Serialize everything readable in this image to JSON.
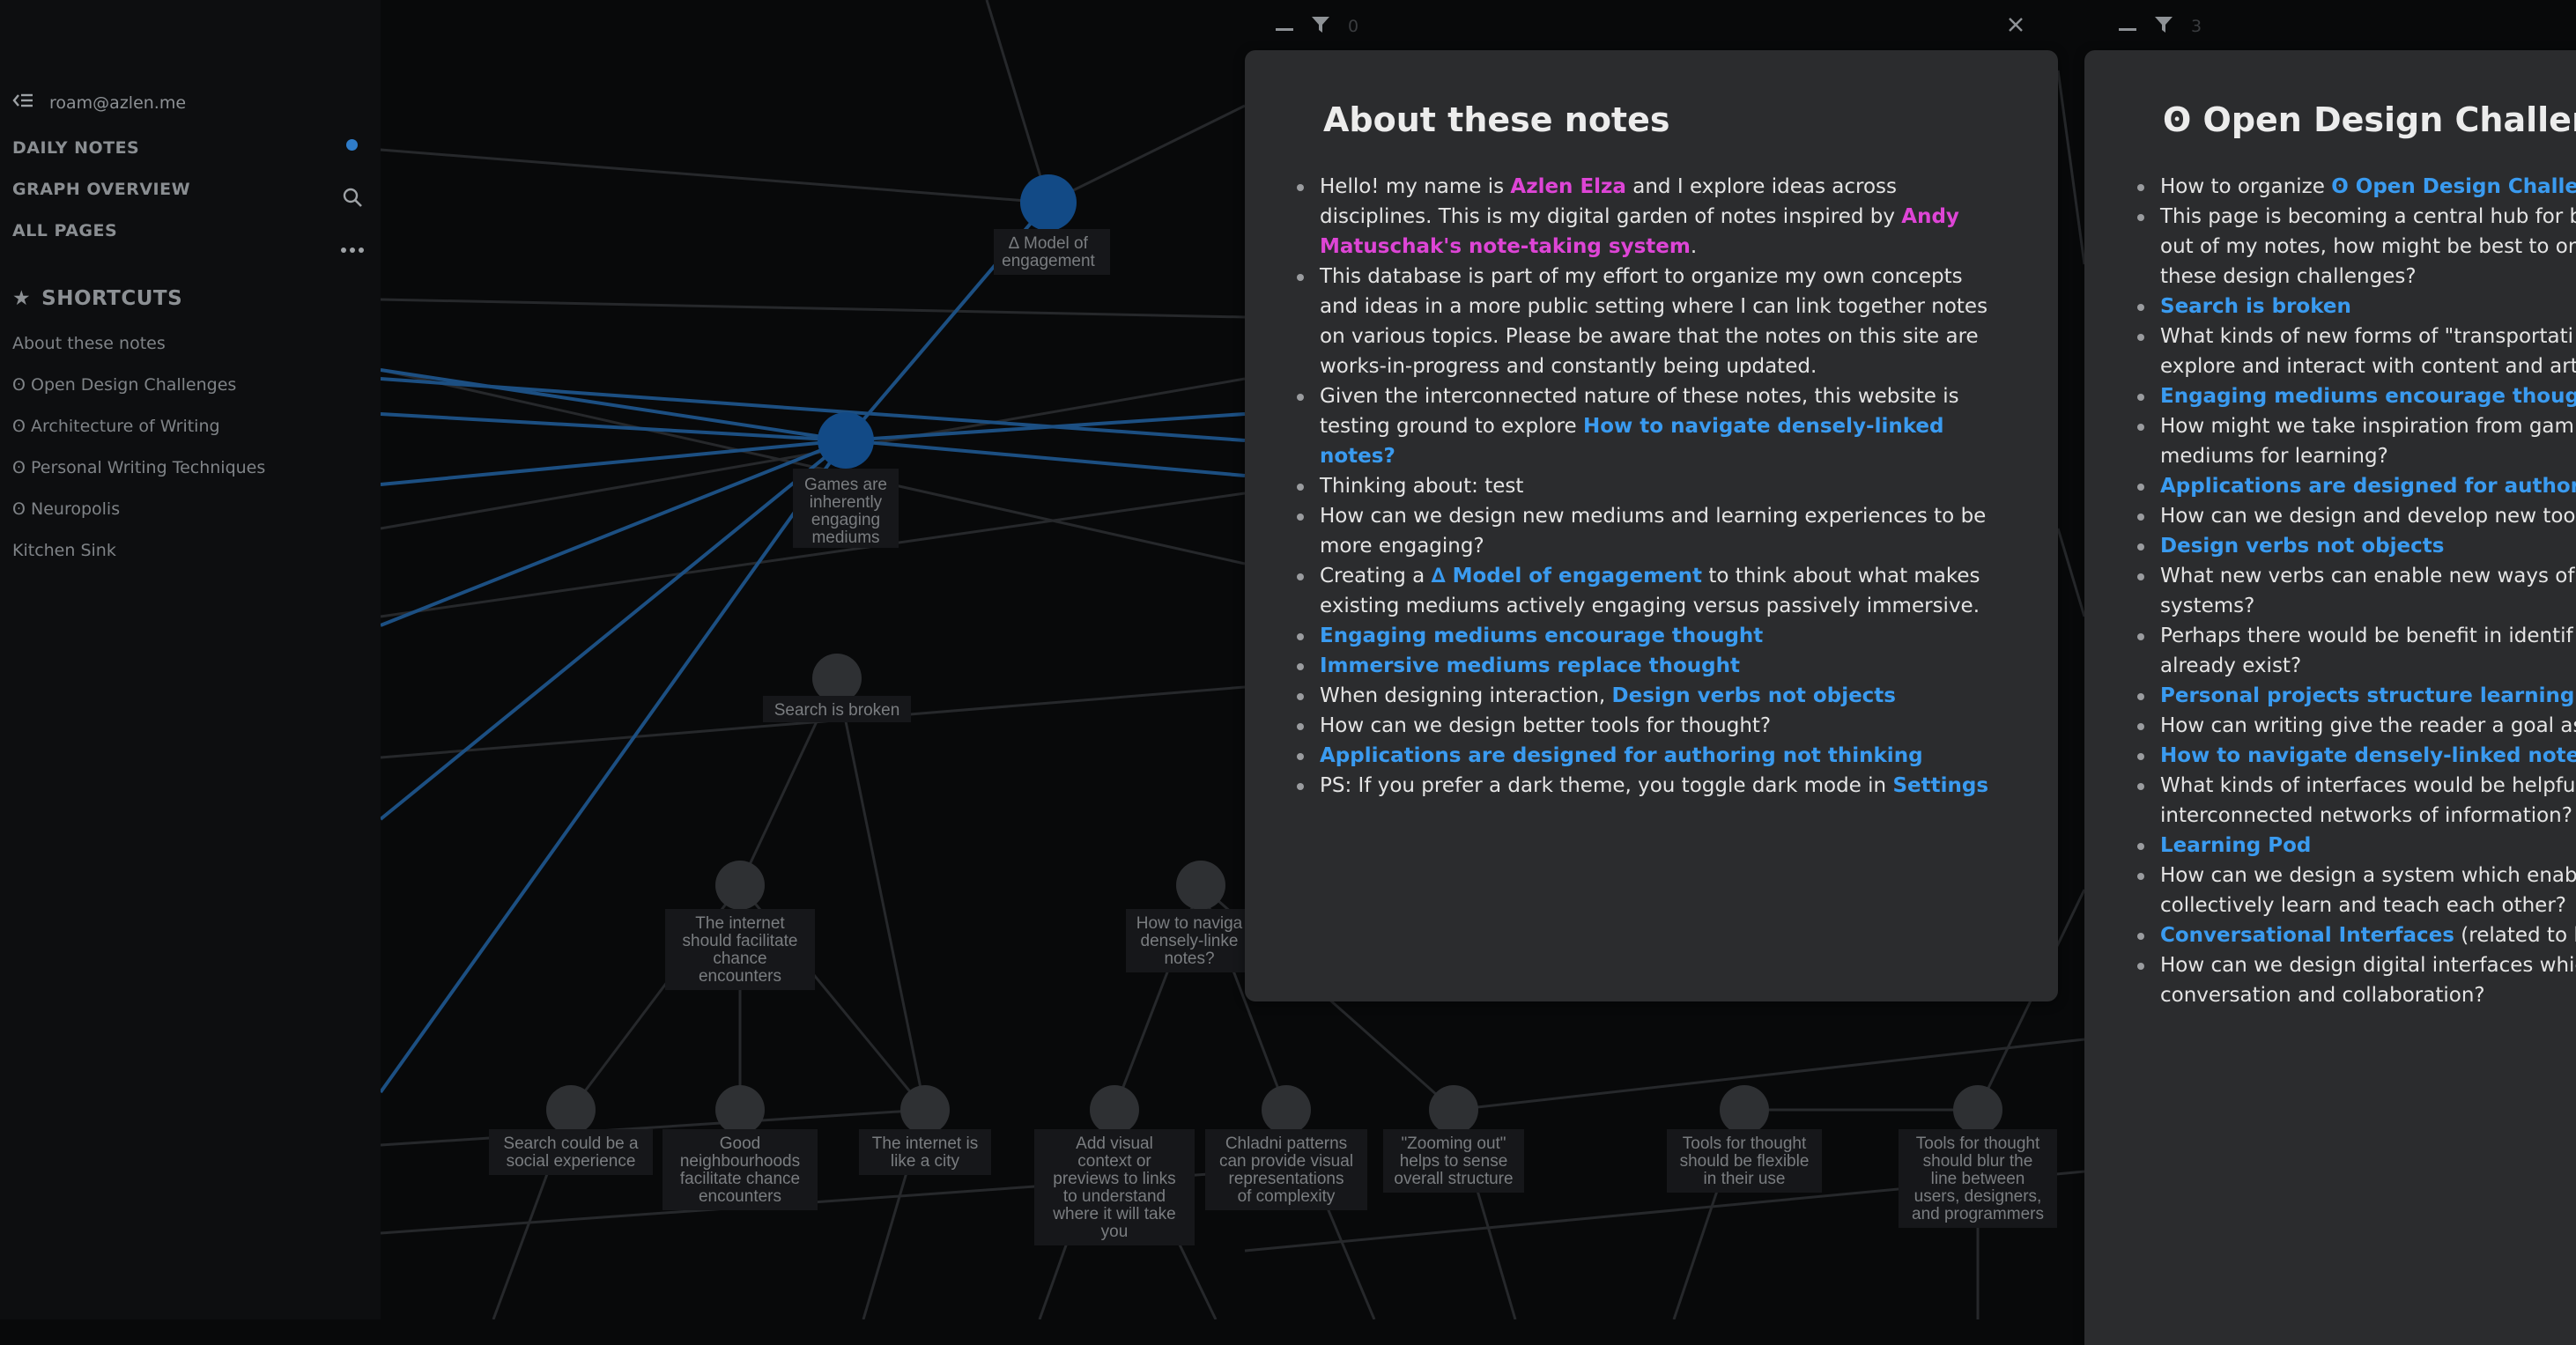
{
  "sidebar": {
    "user": "roam@azlen.me",
    "nav": [
      "DAILY NOTES",
      "GRAPH OVERVIEW",
      "ALL PAGES"
    ],
    "shortcuts_title": "SHORTCUTS",
    "shortcuts": [
      "About these notes",
      "ʘ Open Design Challenges",
      "ʘ Architecture of Writing",
      "ʘ Personal Writing Techniques",
      "ʘ Neuropolis",
      "Kitchen Sink"
    ]
  },
  "panels": {
    "left": {
      "link_count": "0",
      "title": "About these notes",
      "p1_a": "Hello! my name is ",
      "p1_name": "Azlen Elza",
      "p1_b": " and I explore ideas across disciplines. This is my digital garden of notes inspired by ",
      "p1_link": "Andy Matuschak's note-taking system",
      "p1_c": ".",
      "p2": "This database is part of my effort to organize my own concepts and ideas in a more public setting where I can link together notes on various topics. Please be aware that the notes on this site are works-in-progress and constantly being updated.",
      "p3_a": "Given the interconnected nature of these notes, this website is testing ground to explore ",
      "p3_link": "How to navigate densely-linked notes?",
      "p4": "Thinking about: test",
      "q1": "How can we design new mediums and learning experiences to be more engaging?",
      "q1a_a": "Creating a ",
      "q1a_link": "∆ Model of engagement",
      "q1a_b": " to think about what makes existing mediums actively engaging versus passively immersive.",
      "q1b": "Engaging mediums encourage thought",
      "q1c": "Immersive mediums replace thought",
      "q2_a": "When designing interaction, ",
      "q2_link": "Design verbs not objects",
      "q3": "How can we design better tools for thought?",
      "q3a": "Applications are designed for authoring not thinking",
      "p5_a": "PS: If you prefer a dark theme, you toggle dark mode in ",
      "p5_link": "Settings"
    },
    "right": {
      "link_count": "3",
      "title": "ʘ Open Design Challenges",
      "r1_a": "How to organize ",
      "r1_link": "ʘ Open Design Challenges",
      "r1_sub_l1": "This page is becoming a central hub for b",
      "r1_sub_l2": "out of my notes, how might be best to or",
      "r1_sub_l3": "these design challenges?",
      "r2": "Search is broken",
      "r2_sub_l1": "What kinds of new forms of \"transportati",
      "r2_sub_l2": "explore and interact with content and art",
      "r3": "Engaging mediums encourage thought",
      "r3_sub_l1": "How might we take inspiration from gam",
      "r3_sub_l2": "mediums for learning?",
      "r4": "Applications are designed for authoring no",
      "r4_sub": "How can we design and develop new tool",
      "r5": "Design verbs not objects",
      "r5_sub1_l1": "What new verbs can enable new ways of i",
      "r5_sub1_l2": "systems?",
      "r5_sub2_l1": "Perhaps there would be benefit in identif",
      "r5_sub2_l2": "already exist?",
      "r6": "Personal projects structure learning and e",
      "r6_sub": "How can writing give the reader a goal as",
      "r7": "How to navigate densely-linked notes?",
      "r7_sub_l1": "What kinds of interfaces would be helpfu",
      "r7_sub_l2": "interconnected networks of information?",
      "r8": "Learning Pod",
      "r8_sub_l1": "How can we design a system which enabl",
      "r8_sub_l2": "collectively learn and teach each other?",
      "r9_link": "Conversational Interfaces",
      "r9_b": " (related to learni",
      "r9_sub_l1": "How can we design digital interfaces whic",
      "r9_sub_l2": "conversation and collaboration?"
    }
  },
  "graph": {
    "nodes": [
      [
        "∆ Model of",
        "engagement"
      ],
      [
        "Games are",
        "inherently",
        "engaging",
        "mediums"
      ],
      [
        "Search is broken"
      ],
      [
        "The internet",
        "should facilitate",
        "chance",
        "encounters"
      ],
      [
        "How to naviga",
        "densely-linke",
        "notes?"
      ],
      [
        "Search could be a",
        "social experience"
      ],
      [
        "Good",
        "neighbourhoods",
        "facilitate chance",
        "encounters"
      ],
      [
        "The internet is",
        "like a city"
      ],
      [
        "Add visual",
        "context or",
        "previews to links",
        "to understand",
        "where it will take",
        "you"
      ],
      [
        "Chladni patterns",
        "can provide visual",
        "representations",
        "of complexity"
      ],
      [
        "\"Zooming out\"",
        "helps to sense",
        "overall structure"
      ],
      [
        "Tools for thought",
        "should be flexible",
        "in their use"
      ],
      [
        "Tools for thought",
        "should blur the",
        "line between",
        "users, designers,",
        "and programmers"
      ]
    ]
  },
  "colors": {
    "accent": "#3a9bf0",
    "pink": "#de45d6",
    "panel": "#2b2c2e",
    "bg": "#08090a"
  }
}
